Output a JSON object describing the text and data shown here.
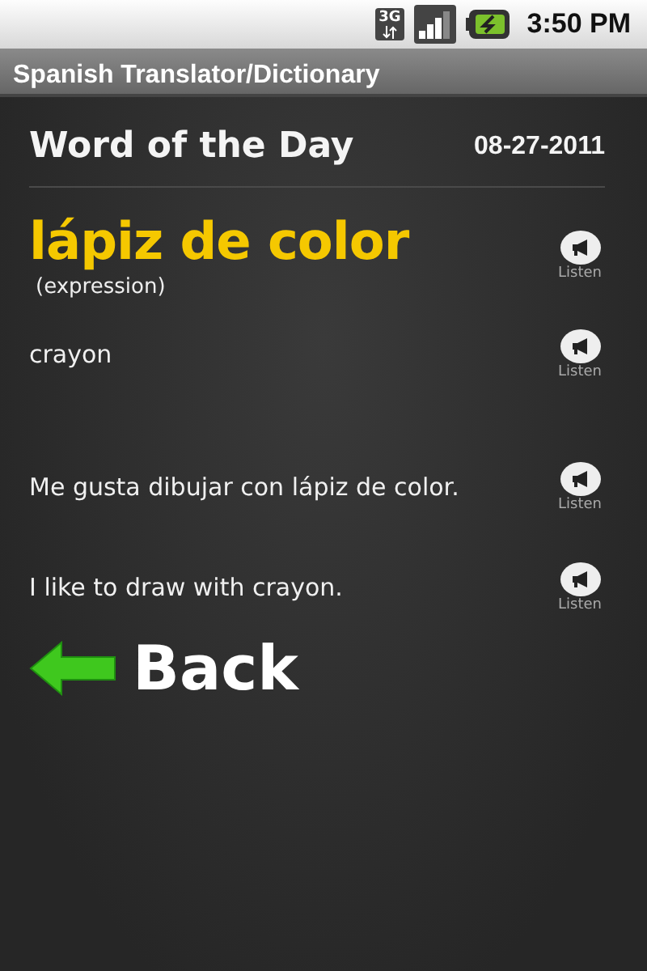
{
  "status_bar": {
    "network": "3G",
    "time": "3:50 PM"
  },
  "window": {
    "title": "Spanish Translator/Dictionary"
  },
  "header": {
    "title": "Word of the Day",
    "date": "08-27-2011"
  },
  "entries": [
    {
      "kind": "word",
      "text": "lápiz de color",
      "note": "(expression)",
      "listen": "Listen"
    },
    {
      "kind": "text",
      "text": "crayon",
      "listen": "Listen"
    },
    {
      "kind": "text",
      "text": "Me gusta dibujar con lápiz de color.",
      "listen": "Listen"
    },
    {
      "kind": "text",
      "text": "I like to draw with crayon.",
      "listen": "Listen"
    }
  ],
  "back_button": {
    "label": "Back"
  }
}
